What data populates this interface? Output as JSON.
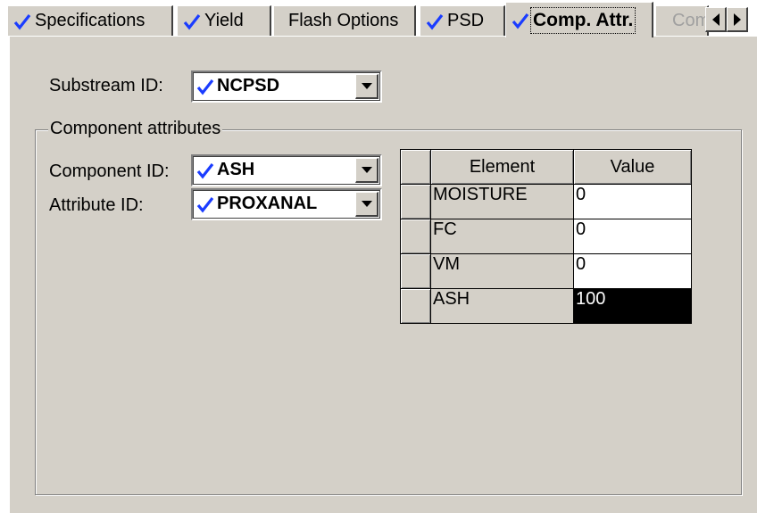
{
  "tabs": [
    {
      "label": "Specifications",
      "checked": true,
      "active": false
    },
    {
      "label": "Yield",
      "checked": true,
      "active": false
    },
    {
      "label": "Flash Options",
      "checked": false,
      "active": false
    },
    {
      "label": "PSD",
      "checked": true,
      "active": false
    },
    {
      "label": "Comp. Attr.",
      "checked": true,
      "active": true
    },
    {
      "label": "Com",
      "checked": false,
      "active": false
    }
  ],
  "substream": {
    "label": "Substream ID:",
    "value": "NCPSD"
  },
  "component_attributes": {
    "group_title": "Component attributes",
    "component_label": "Component ID:",
    "component_value": "ASH",
    "attribute_label": "Attribute ID:",
    "attribute_value": "PROXANAL"
  },
  "grid": {
    "columns": [
      "Element",
      "Value"
    ],
    "rows": [
      {
        "element": "MOISTURE",
        "value": "0"
      },
      {
        "element": "FC",
        "value": "0"
      },
      {
        "element": "VM",
        "value": "0"
      },
      {
        "element": "ASH",
        "value": "100"
      }
    ]
  },
  "colors": {
    "check": "#1a3cff",
    "panel": "#d4d0c8",
    "selected_cell": "#000000"
  }
}
